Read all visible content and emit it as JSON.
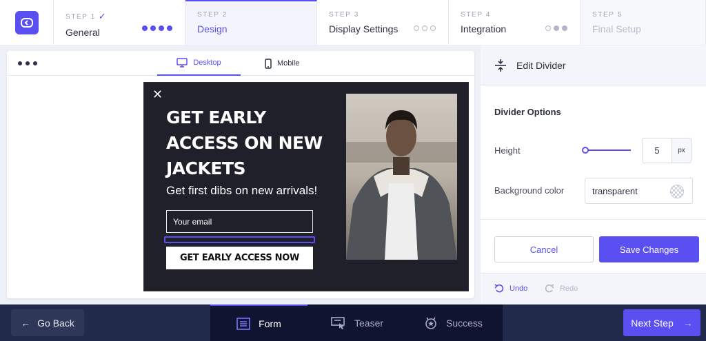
{
  "steps": [
    {
      "num": "STEP 1",
      "title": "General"
    },
    {
      "num": "STEP 2",
      "title": "Design"
    },
    {
      "num": "STEP 3",
      "title": "Display Settings"
    },
    {
      "num": "STEP 4",
      "title": "Integration"
    },
    {
      "num": "STEP 5",
      "title": "Final Setup"
    }
  ],
  "preview": {
    "tabs": {
      "desktop": "Desktop",
      "mobile": "Mobile"
    },
    "popup": {
      "headline": "GET EARLY ACCESS ON NEW JACKETS",
      "subhead": "Get first dibs on new arrivals!",
      "email_placeholder": "Your email",
      "cta": "GET EARLY ACCESS NOW"
    }
  },
  "panel": {
    "title": "Edit Divider",
    "section": "Divider Options",
    "height_label": "Height",
    "height_value": "5",
    "height_unit": "px",
    "height_slider_fraction": 0.05,
    "bg_label": "Background color",
    "bg_value": "transparent",
    "cancel": "Cancel",
    "save": "Save Changes",
    "undo": "Undo",
    "redo": "Redo"
  },
  "bottom": {
    "back": "Go Back",
    "tabs": {
      "form": "Form",
      "teaser": "Teaser",
      "success": "Success"
    },
    "next": "Next Step"
  },
  "colors": {
    "accent": "#5a4ff0",
    "bottom_bar": "#212a4a",
    "popup_bg": "#1f2029"
  }
}
